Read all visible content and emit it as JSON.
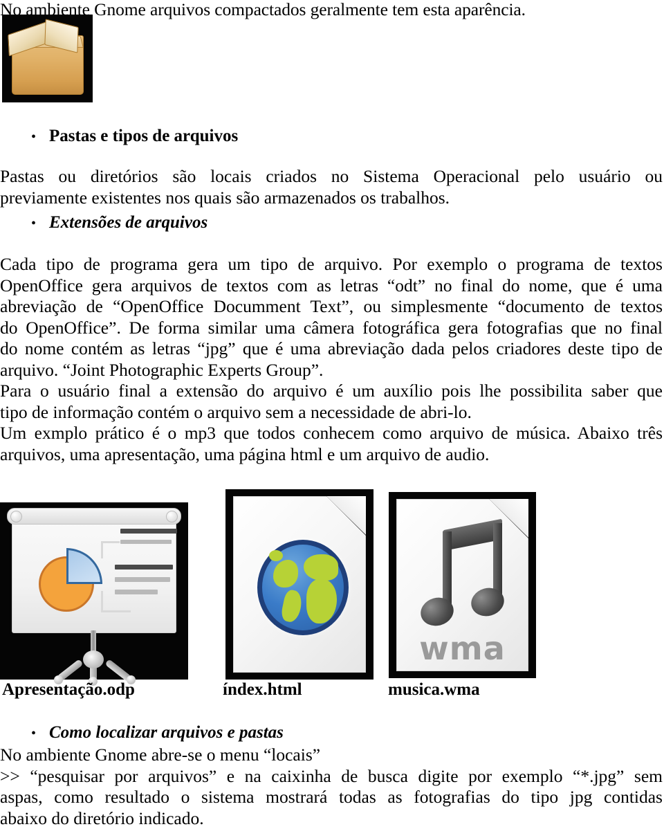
{
  "document": {
    "intro_line": "No ambiente Gnome arquivos compactados geralmente tem esta aparência.",
    "archive_icon_name": "archive-box-icon",
    "sections": [
      {
        "bullet": "•",
        "heading": "Pastas e tipos de arquivos",
        "heading_style": "bold",
        "body_lines": [
          "Pastas ou diretórios são locais criados no Sistema Operacional pelo usuário ou",
          "previamente existentes nos quais são armazenados os trabalhos."
        ]
      },
      {
        "bullet": "•",
        "heading": "Extensões de arquivos",
        "heading_style": "bold-italic",
        "body_lines": [
          "Cada tipo de programa gera um tipo de arquivo. Por exemplo o programa de textos",
          "OpenOffice gera arquivos de textos com as letras “odt” no final do nome, que é uma",
          "abreviação de “OpenOffice Documment Text”, ou simplesmente “documento de textos",
          "do OpenOffice”. De forma similar uma câmera fotográfica gera fotografias que no final",
          "do nome contém as letras “jpg” que é uma abreviação dada pelos criadores deste tipo de",
          "arquivo. “Joint Photographic Experts Group”.",
          "Para o usuário final a extensão do arquivo é um auxílio pois lhe possibilita saber que",
          "tipo de informação contém o arquivo sem a necessidade de abri-lo.",
          "Um exmplo prático é o mp3 que todos conhecem como arquivo de música. Abaixo três",
          "arquivos, uma apresentação, uma página html e um arquivo de audio."
        ]
      },
      {
        "bullet": "•",
        "heading": "Como localizar arquivos e pastas",
        "heading_style": "bold-italic",
        "body_lines": [
          "No ambiente Gnome abre-se o menu “locais”",
          ">> “pesquisar por arquivos” e na caixinha de busca digite por exemplo “*.jpg” sem",
          "aspas, como resultado o sistema mostrará todas as fotografias do tipo jpg contidas",
          "abaixo do diretório indicado."
        ]
      }
    ],
    "file_examples": [
      {
        "icon": "presentation-screen-icon",
        "label": "Apresentação.odp"
      },
      {
        "icon": "html-globe-document-icon",
        "label": "índex.html"
      },
      {
        "icon": "music-note-wma-document-icon",
        "label": "musica.wma",
        "badge_text": "wma"
      }
    ],
    "colors": {
      "archive_box": "#e0b070",
      "pie_orange": "#F4A33C",
      "pie_blue": "#a9c9e9",
      "globe_ocean": "#3a7bc8",
      "globe_land": "#b7d236",
      "globe_ring": "#1f3f7a",
      "note_dark": "#3b3b3b",
      "wma_text": "#9a9a9a",
      "icon_backdrop": "#050505",
      "text": "#000000"
    }
  }
}
